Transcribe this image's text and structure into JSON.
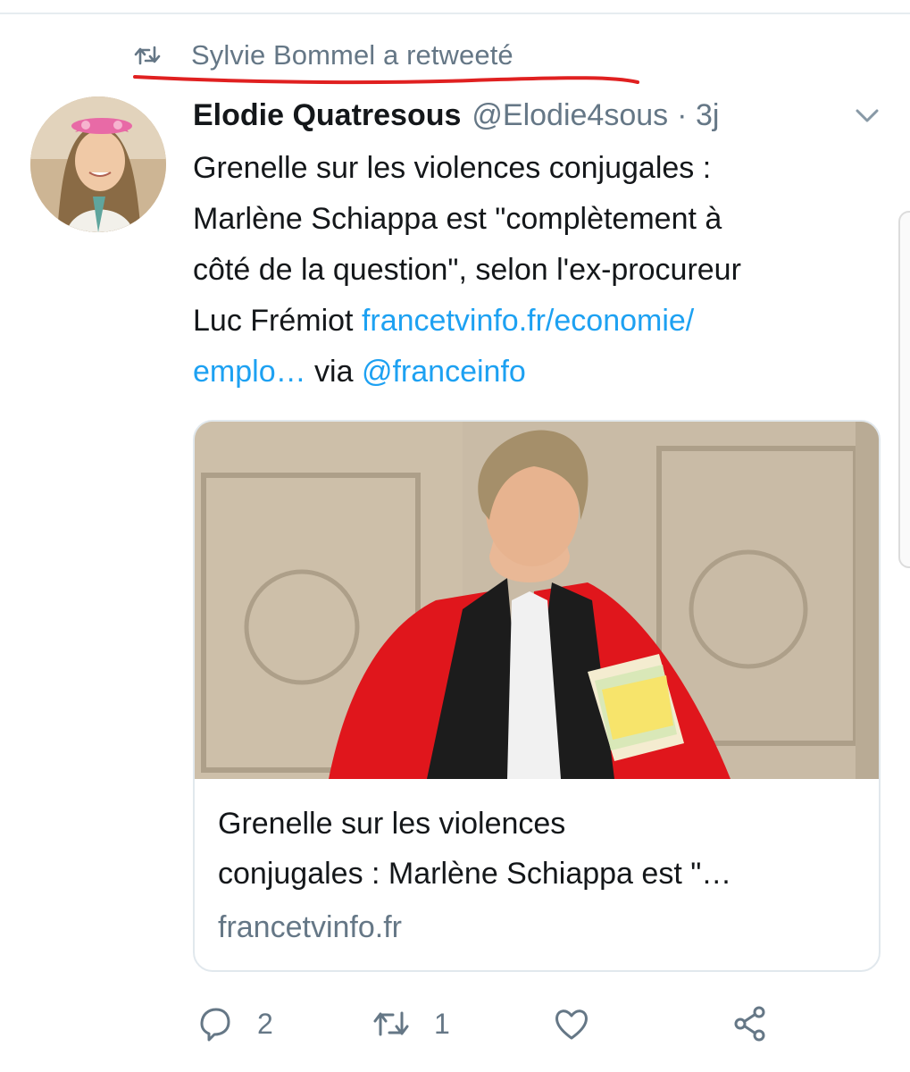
{
  "retweet_context": {
    "icon": "retweet-icon",
    "text": "Sylvie Bommel a retweeté",
    "underline_color": "#e02020"
  },
  "tweet": {
    "author": {
      "name": "Elodie Quatresous",
      "handle": "@Elodie4sous",
      "time": "· 3j"
    },
    "text_lines": [
      "Grenelle sur les violences conjugales :",
      "Marlène Schiappa est \"complètement à",
      "côté de la question\", selon l'ex-procureur"
    ],
    "line4_prefix": "Luc Frémiot ",
    "link_part1": "francetvinfo.fr/economie/",
    "link_part2": "emplo…",
    "via_text": " via ",
    "mention": "@franceinfo",
    "card": {
      "title_lines": [
        "Grenelle sur les violences",
        "conjugales : Marlène Schiappa est \"…"
      ],
      "domain": "francetvinfo.fr"
    },
    "actions": {
      "reply_count": "2",
      "retweet_count": "1",
      "like_count": "",
      "share_icon": "share-icon"
    }
  },
  "colors": {
    "link": "#1da1f2",
    "secondary_text": "#657786",
    "primary_text": "#14171a",
    "robe_red": "#e0161c"
  }
}
